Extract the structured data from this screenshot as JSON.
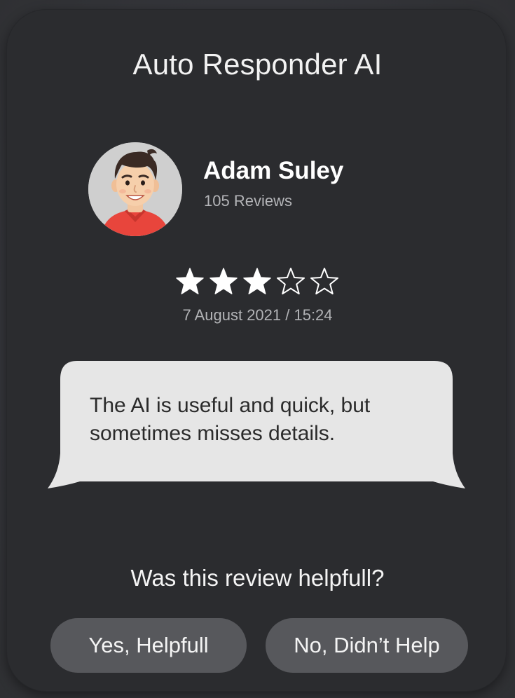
{
  "app": {
    "title": "Auto Responder AI"
  },
  "review": {
    "user_name": "Adam Suley",
    "user_reviews": "105 Reviews",
    "rating": 3,
    "rating_max": 5,
    "date": "7 August 2021 / 15:24",
    "text": "The AI is useful and quick, but sometimes misses details."
  },
  "feedback": {
    "question": "Was this review helpfull?",
    "yes_label": "Yes, Helpfull",
    "no_label": "No, Didn’t Help"
  },
  "colors": {
    "background": "#2b2c2f",
    "bubble": "#e6e6e6",
    "button": "#57585c",
    "star": "#ffffff",
    "avatar_shirt": "#e8453c"
  },
  "icons": {
    "avatar": "user-avatar",
    "star_filled": "star-filled-icon",
    "star_empty": "star-outline-icon"
  }
}
